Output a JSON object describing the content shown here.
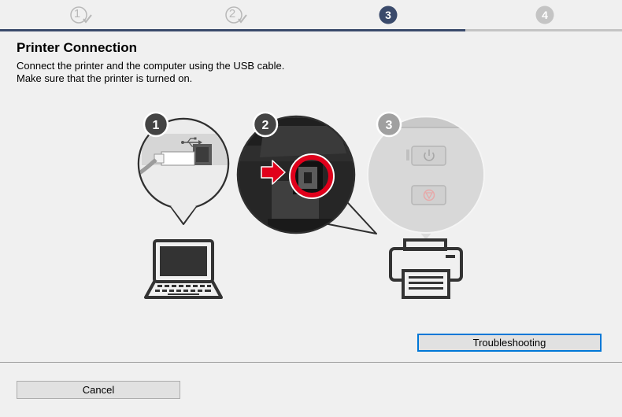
{
  "steps": [
    {
      "label": "1",
      "state": "done"
    },
    {
      "label": "2",
      "state": "done"
    },
    {
      "label": "3",
      "state": "current"
    },
    {
      "label": "4",
      "state": "upcoming"
    }
  ],
  "colors": {
    "progress_active": "#3a4a6b",
    "progress_inactive": "#c4c4c4",
    "accent": "#0078d7",
    "highlight_ring": "#e0001b",
    "arrow": "#e0001b"
  },
  "page": {
    "title": "Printer Connection",
    "line1": "Connect the printer and the computer using the USB cable.",
    "line2": "Make sure that the printer is turned on."
  },
  "illustration": {
    "callouts": [
      "1",
      "2",
      "3"
    ],
    "icons": [
      "usb-icon",
      "laptop-icon",
      "printer-icon",
      "power-icon",
      "stop-icon"
    ]
  },
  "buttons": {
    "troubleshooting": "Troubleshooting",
    "cancel": "Cancel"
  }
}
